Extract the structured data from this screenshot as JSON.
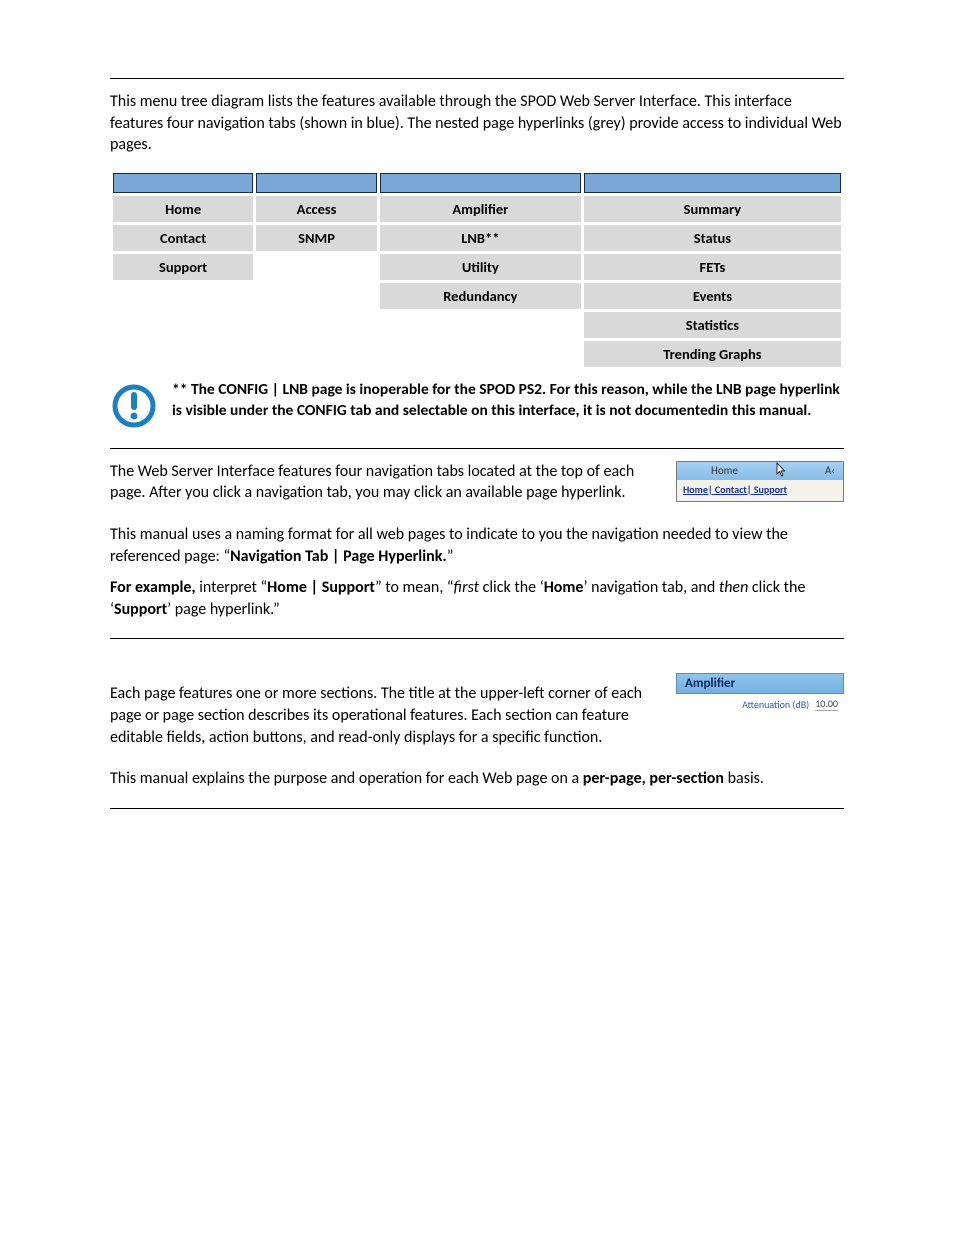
{
  "section_menu": {
    "intro": "This menu tree diagram lists the features available through the SPOD Web Server Interface. This interface features four navigation tabs (shown in blue). The nested page hyperlinks (grey) provide access to individual Web pages.",
    "columns": [
      [
        "Home",
        "Contact",
        "Support"
      ],
      [
        "Access",
        "SNMP"
      ],
      [
        "Amplifier",
        "LNB**",
        "Utility",
        "Redundancy"
      ],
      [
        "Summary",
        "Status",
        "FETs",
        "Events",
        "Statistics",
        "Trending Graphs"
      ]
    ],
    "note": "** The CONFIG | LNB page is inoperable for the SPOD PS2. For this reason, while the LNB page hyperlink is visible under the CONFIG tab and selectable on this interface, it is not documentedin this manual."
  },
  "section_nav": {
    "p1": "The Web Server Interface features four navigation tabs located at the top of each page. After you click a navigation tab, you may click an available page hyperlink.",
    "p2a": "This manual uses a naming format for all web pages to indicate to you the navigation needed to view the referenced page: “",
    "p2b": "Navigation Tab | Page Hyperlink.",
    "p2c": "”",
    "ex1": "For example,",
    "ex2": " interpret “",
    "ex3": "Home | Support",
    "ex4": "” to mean, “",
    "ex5": "first",
    "ex6": " click the ‘",
    "ex7": "Home",
    "ex8": "’ navigation tab, and ",
    "ex9": "then",
    "ex10": " click the ‘",
    "ex11": "Support",
    "ex12": "’ page hyperlink.”",
    "thumb": {
      "tab_left": "Home",
      "tab_right": "A‹",
      "links": "Home| Contact| Support"
    }
  },
  "section_sections": {
    "p1": "Each page features one or more sections. The title at the upper-left corner of each page or page section describes its operational features. Each section can feature editable fields, action buttons, and read-only displays for a specific function.",
    "p2a": "This manual explains the purpose and operation for each Web page on a ",
    "p2b": "per-page, per-section",
    "p2c": " basis.",
    "thumb": {
      "header": "Amplifier",
      "label": "Attenuation (dB)",
      "value": "10.00"
    }
  }
}
